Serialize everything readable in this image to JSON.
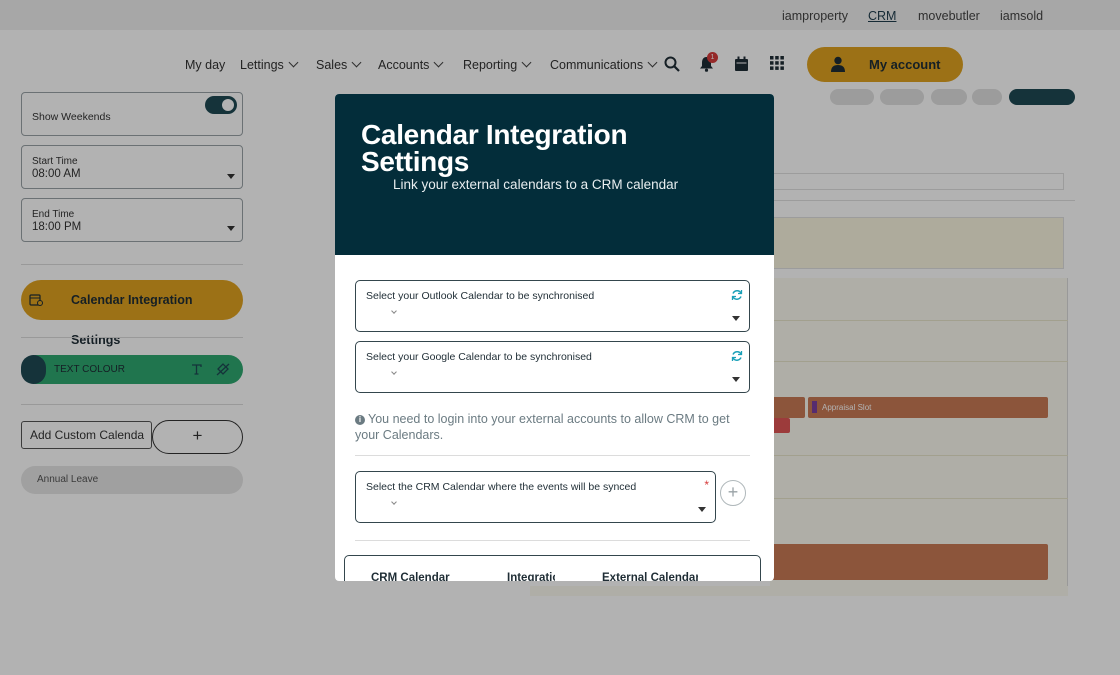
{
  "topbar": {
    "links": [
      "iamproperty",
      "CRM",
      "movebutler",
      "iamsold"
    ],
    "active": "CRM"
  },
  "nav": {
    "items": [
      "My day",
      "Lettings",
      "Sales",
      "Accounts",
      "Reporting",
      "Communications"
    ],
    "notification_count": "1",
    "account_label": "My account"
  },
  "sidebar": {
    "show_weekends_label": "Show Weekends",
    "start_time": {
      "label": "Start Time",
      "value": "08:00 AM"
    },
    "end_time": {
      "label": "End Time",
      "value": "18:00 PM"
    },
    "calendar_integration_label": "Calendar Integration Settings",
    "text_colour_label": "TEXT COLOUR",
    "add_custom_calendar_label": "Add Custom Calenda",
    "add_plus": "+",
    "annual_leave_label": "Annual Leave"
  },
  "calendar": {
    "event_label": "Appraisal Slot"
  },
  "modal": {
    "title": "Calendar Integration Settings",
    "subtitle": "Link your external calendars to a CRM calendar",
    "outlook_label": "Select your Outlook Calendar to be synchronised",
    "google_label": "Select your Google Calendar to be synchronised",
    "info_text": "You need to login into your external accounts to allow CRM to get your Calendars.",
    "info_icon": "i",
    "crm_select_label": "Select the CRM Calendar where the events will be synced",
    "required_mark": "*",
    "add_plus": "+",
    "table_headers": [
      "CRM Calendar",
      "Integration",
      "External Calendar"
    ]
  },
  "colors": {
    "header_bg": "#032d3a",
    "accent_gold": "#e0a320",
    "accent_green": "#2ea870",
    "refresh_teal": "#1aa0b8"
  }
}
